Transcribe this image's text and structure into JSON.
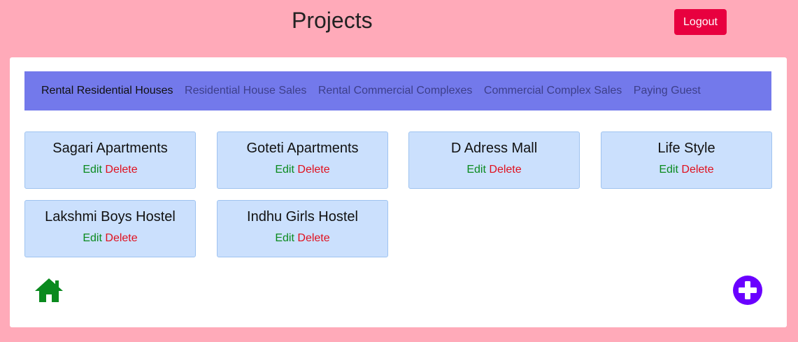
{
  "header": {
    "title": "Projects",
    "logout_label": "Logout"
  },
  "tabs": [
    {
      "label": "Rental Residential Houses",
      "active": true
    },
    {
      "label": "Residential House Sales",
      "active": false
    },
    {
      "label": "Rental Commercial Complexes",
      "active": false
    },
    {
      "label": "Commercial Complex Sales",
      "active": false
    },
    {
      "label": "Paying Guest",
      "active": false
    }
  ],
  "projects": [
    {
      "name": "Sagari Apartments",
      "edit": "Edit",
      "delete": "Delete"
    },
    {
      "name": "Goteti Apartments",
      "edit": "Edit",
      "delete": "Delete"
    },
    {
      "name": "D Adress Mall",
      "edit": "Edit",
      "delete": "Delete"
    },
    {
      "name": "Life Style",
      "edit": "Edit",
      "delete": "Delete"
    },
    {
      "name": "Lakshmi Boys Hostel",
      "edit": "Edit",
      "delete": "Delete"
    },
    {
      "name": "Indhu Girls Hostel",
      "edit": "Edit",
      "delete": "Delete"
    }
  ],
  "icons": {
    "home": "home-icon",
    "add": "plus-circle-icon"
  },
  "colors": {
    "page_background": "#ffaab9",
    "logout": "#e8003f",
    "tab_bar": "#7379eb",
    "card": "#cbe0fd",
    "edit": "#0a8a1e",
    "delete": "#e0101e",
    "home_icon": "#0a8a1e",
    "add_icon": "#6a00ff"
  }
}
